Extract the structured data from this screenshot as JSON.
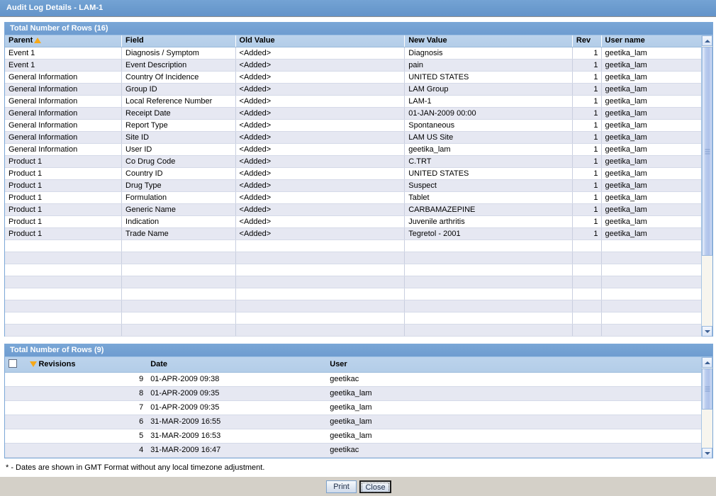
{
  "window": {
    "title": "Audit Log Details - LAM-1"
  },
  "audit_panel": {
    "header": "Total Number of Rows (16)",
    "columns": [
      {
        "key": "parent",
        "label": "Parent",
        "sort": "asc",
        "align": "left"
      },
      {
        "key": "field",
        "label": "Field",
        "sort": "none",
        "align": "left"
      },
      {
        "key": "old_value",
        "label": "Old Value",
        "sort": "none",
        "align": "left"
      },
      {
        "key": "new_value",
        "label": "New Value",
        "sort": "none",
        "align": "left"
      },
      {
        "key": "rev",
        "label": "Rev",
        "sort": "none",
        "align": "right"
      },
      {
        "key": "user_name",
        "label": "User name",
        "sort": "none",
        "align": "left"
      }
    ],
    "rows": [
      {
        "parent": "Event 1",
        "field": "Diagnosis / Symptom",
        "old_value": "<Added>",
        "new_value": "Diagnosis",
        "rev": "1",
        "user_name": "geetika_lam"
      },
      {
        "parent": "Event 1",
        "field": "Event Description",
        "old_value": "<Added>",
        "new_value": "pain",
        "rev": "1",
        "user_name": "geetika_lam"
      },
      {
        "parent": "General Information",
        "field": "Country Of Incidence",
        "old_value": "<Added>",
        "new_value": "UNITED STATES",
        "rev": "1",
        "user_name": "geetika_lam"
      },
      {
        "parent": "General Information",
        "field": "Group ID",
        "old_value": "<Added>",
        "new_value": "LAM Group",
        "rev": "1",
        "user_name": "geetika_lam"
      },
      {
        "parent": "General Information",
        "field": "Local Reference Number",
        "old_value": "<Added>",
        "new_value": "LAM-1",
        "rev": "1",
        "user_name": "geetika_lam"
      },
      {
        "parent": "General Information",
        "field": "Receipt Date",
        "old_value": "<Added>",
        "new_value": "01-JAN-2009 00:00",
        "rev": "1",
        "user_name": "geetika_lam"
      },
      {
        "parent": "General Information",
        "field": "Report Type",
        "old_value": "<Added>",
        "new_value": "Spontaneous",
        "rev": "1",
        "user_name": "geetika_lam"
      },
      {
        "parent": "General Information",
        "field": "Site ID",
        "old_value": "<Added>",
        "new_value": "LAM US Site",
        "rev": "1",
        "user_name": "geetika_lam"
      },
      {
        "parent": "General Information",
        "field": "User ID",
        "old_value": "<Added>",
        "new_value": "geetika_lam",
        "rev": "1",
        "user_name": "geetika_lam"
      },
      {
        "parent": "Product 1",
        "field": "Co Drug Code",
        "old_value": "<Added>",
        "new_value": "C.TRT",
        "rev": "1",
        "user_name": "geetika_lam"
      },
      {
        "parent": "Product 1",
        "field": "Country ID",
        "old_value": "<Added>",
        "new_value": "UNITED STATES",
        "rev": "1",
        "user_name": "geetika_lam"
      },
      {
        "parent": "Product 1",
        "field": "Drug Type",
        "old_value": "<Added>",
        "new_value": "Suspect",
        "rev": "1",
        "user_name": "geetika_lam"
      },
      {
        "parent": "Product 1",
        "field": "Formulation",
        "old_value": "<Added>",
        "new_value": "Tablet",
        "rev": "1",
        "user_name": "geetika_lam"
      },
      {
        "parent": "Product 1",
        "field": "Generic Name",
        "old_value": "<Added>",
        "new_value": "CARBAMAZEPINE",
        "rev": "1",
        "user_name": "geetika_lam"
      },
      {
        "parent": "Product 1",
        "field": "Indication",
        "old_value": "<Added>",
        "new_value": "Juvenile arthritis",
        "rev": "1",
        "user_name": "geetika_lam"
      },
      {
        "parent": "Product 1",
        "field": "Trade Name",
        "old_value": "<Added>",
        "new_value": "Tegretol - 2001",
        "rev": "1",
        "user_name": "geetika_lam"
      }
    ],
    "empty_row_count": 9,
    "scrollbar": {
      "up_icon": "scroll-up-arrow-icon",
      "down_icon": "scroll-down-arrow-icon"
    }
  },
  "revisions_panel": {
    "header": "Total Number of Rows (9)",
    "columns": [
      {
        "key": "select",
        "label": "",
        "sort": "none",
        "align": "left"
      },
      {
        "key": "revisions",
        "label": "Revisions",
        "sort": "desc",
        "align": "right"
      },
      {
        "key": "date",
        "label": "Date",
        "sort": "none",
        "align": "left"
      },
      {
        "key": "user",
        "label": "User",
        "sort": "none",
        "align": "left"
      }
    ],
    "rows": [
      {
        "revisions": "9",
        "date": "01-APR-2009 09:38",
        "user": "geetikac"
      },
      {
        "revisions": "8",
        "date": "01-APR-2009 09:35",
        "user": "geetika_lam"
      },
      {
        "revisions": "7",
        "date": "01-APR-2009 09:35",
        "user": "geetika_lam"
      },
      {
        "revisions": "6",
        "date": "31-MAR-2009 16:55",
        "user": "geetika_lam"
      },
      {
        "revisions": "5",
        "date": "31-MAR-2009 16:53",
        "user": "geetika_lam"
      },
      {
        "revisions": "4",
        "date": "31-MAR-2009 16:47",
        "user": "geetikac"
      }
    ],
    "scrollbar": {
      "up_icon": "scroll-up-arrow-icon",
      "down_icon": "scroll-down-arrow-icon"
    }
  },
  "footer": {
    "note": "* - Dates are shown in GMT Format without any local timezone adjustment.",
    "print_label": "Print",
    "close_label": "Close"
  },
  "colors": {
    "titlebar": "#6b9bce",
    "panel_header": "#6e9cd0",
    "column_header": "#b6cfe9",
    "row_alt": "#e6e8f2",
    "sort_arrow": "#f6a819",
    "button_bar": "#d4d0c8"
  }
}
